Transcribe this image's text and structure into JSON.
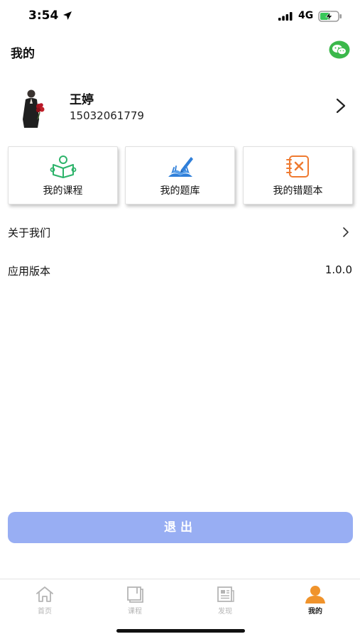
{
  "status_bar": {
    "time": "3:54",
    "network": "4G"
  },
  "header": {
    "title": "我的"
  },
  "profile": {
    "name": "王婷",
    "phone": "15032061779"
  },
  "cards": [
    {
      "label": "我的课程",
      "icon": "reading-person-icon",
      "color": "#2db36a"
    },
    {
      "label": "我的题库",
      "icon": "open-book-pen-icon",
      "color": "#2f7fd9"
    },
    {
      "label": "我的错题本",
      "icon": "error-notebook-icon",
      "color": "#ef7a30"
    }
  ],
  "menu": [
    {
      "label": "关于我们",
      "value": ""
    },
    {
      "label": "应用版本",
      "value": "1.0.0"
    }
  ],
  "logout": {
    "label": "退出"
  },
  "tabs": [
    {
      "label": "首页",
      "icon": "home-icon",
      "active": false
    },
    {
      "label": "课程",
      "icon": "book-icon",
      "active": false
    },
    {
      "label": "发现",
      "icon": "newspaper-icon",
      "active": false
    },
    {
      "label": "我的",
      "icon": "person-icon",
      "active": true
    }
  ],
  "colors": {
    "accent_orange": "#f0932b",
    "logout_bg": "#98aef3",
    "wechat_green": "#3bb84b",
    "inactive_tab": "#b5b5b5"
  }
}
